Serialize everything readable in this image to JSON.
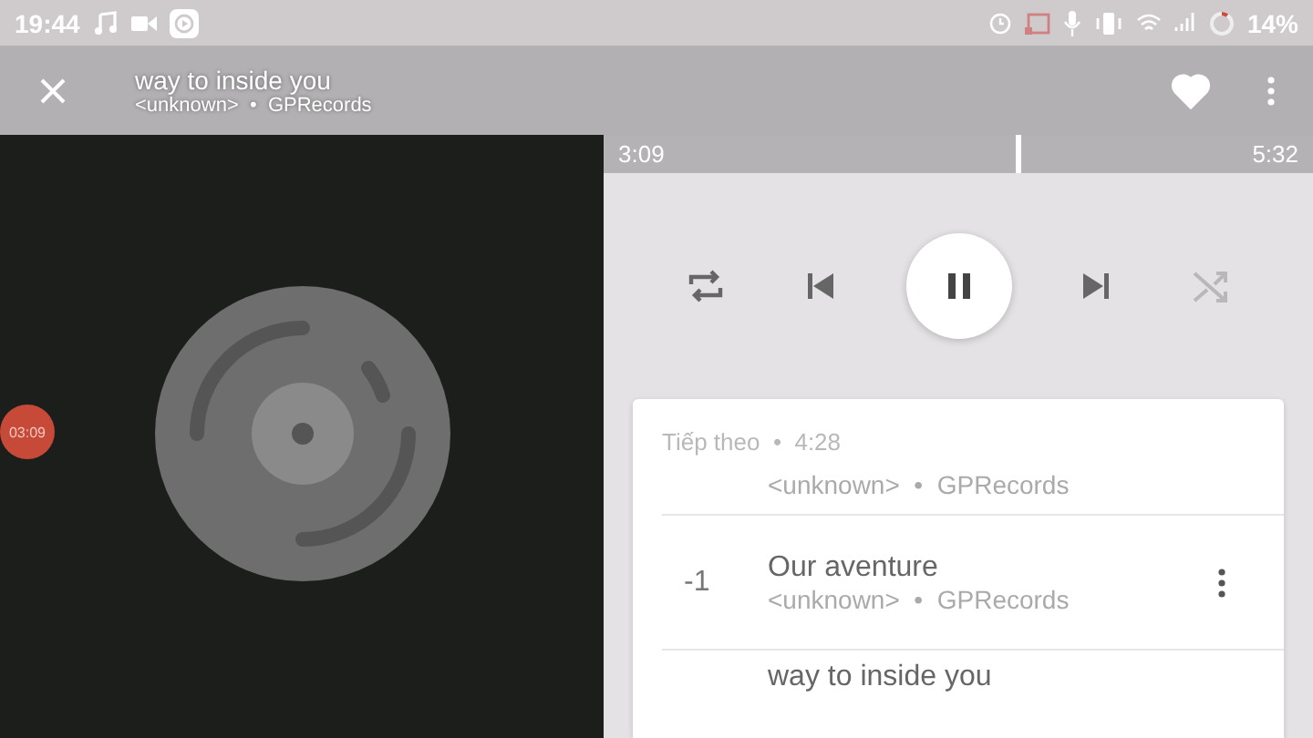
{
  "status_bar": {
    "time": "19:44",
    "battery": "14%"
  },
  "header": {
    "title": "way to inside you",
    "artist": "<unknown>",
    "separator": "•",
    "album": "GPRecords",
    "liked": true
  },
  "timer_badge": "03:09",
  "progress": {
    "elapsed": "3:09",
    "total": "5:32",
    "level": 0.58
  },
  "controls": {
    "repeat": true,
    "shuffle": false,
    "playing": true
  },
  "queue": {
    "heading": "Tiếp theo",
    "separator": "•",
    "duration": "4:28",
    "items": [
      {
        "kind": "partial",
        "artist": "<unknown>",
        "separator": "•",
        "album": "GPRecords"
      },
      {
        "kind": "full",
        "number": "-1",
        "title": "Our aventure",
        "artist": "<unknown>",
        "separator": "•",
        "album": "GPRecords"
      },
      {
        "kind": "title",
        "title": "way to inside you"
      }
    ]
  }
}
